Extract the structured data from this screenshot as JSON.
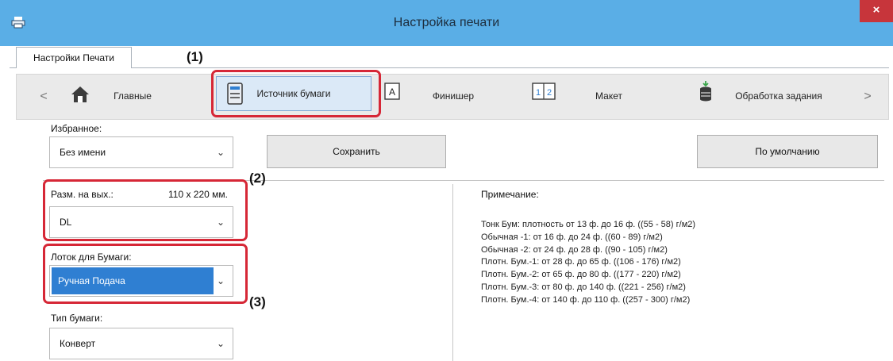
{
  "window": {
    "title": "Настройка печати",
    "close_glyph": "×",
    "app_icon": "printer-icon"
  },
  "tab": {
    "label": "Настройки Печати"
  },
  "nav": {
    "left_arrow": "<",
    "right_arrow": ">",
    "items": [
      {
        "label": "Главные",
        "icon": "home-icon"
      },
      {
        "label": "Источник бумаги",
        "icon": "paper-tray-icon"
      },
      {
        "label": "Финишер",
        "icon": "finisher-icon"
      },
      {
        "label": "Макет",
        "icon": "layout-icon"
      },
      {
        "label": "Обработка задания",
        "icon": "job-handling-icon"
      }
    ]
  },
  "favorites": {
    "label": "Избранное:",
    "value": "Без имени",
    "save_label": "Сохранить",
    "default_label": "По умолчанию"
  },
  "output_size": {
    "label": "Разм. на вых.:",
    "dimension": "110 x 220 мм.",
    "value": "DL"
  },
  "paper_tray": {
    "label": "Лоток для Бумаги:",
    "value": "Ручная Подача"
  },
  "paper_type": {
    "label": "Тип бумаги:",
    "value": "Конверт"
  },
  "note": {
    "title": "Примечание:",
    "lines": [
      "Тонк Бум: плотность от 13 ф. до 16 ф. ((55 - 58) г/м2)",
      "Обычная -1: от 16 ф. до 24 ф. ((60 - 89) г/м2)",
      "Обычная -2: от 24 ф. до 28 ф. ((90 - 105) г/м2)",
      "Плотн. Бум.-1: от 28 ф. до 65 ф. ((106 - 176) г/м2)",
      "Плотн. Бум.-2: от 65 ф. до 80 ф. ((177 - 220) г/м2)",
      "Плотн. Бум.-3: от 80 ф. до 140 ф. ((221 - 256) г/м2)",
      "Плотн. Бум.-4: от 140 ф. до 110 ф. ((257 - 300) г/м2)"
    ]
  },
  "callouts": {
    "c1": "(1)",
    "c2": "(2)",
    "c3": "(3)"
  },
  "colors": {
    "titlebar": "#5aaee6",
    "highlight_box": "#d62736",
    "selected_tray": "#2f7fd2"
  }
}
